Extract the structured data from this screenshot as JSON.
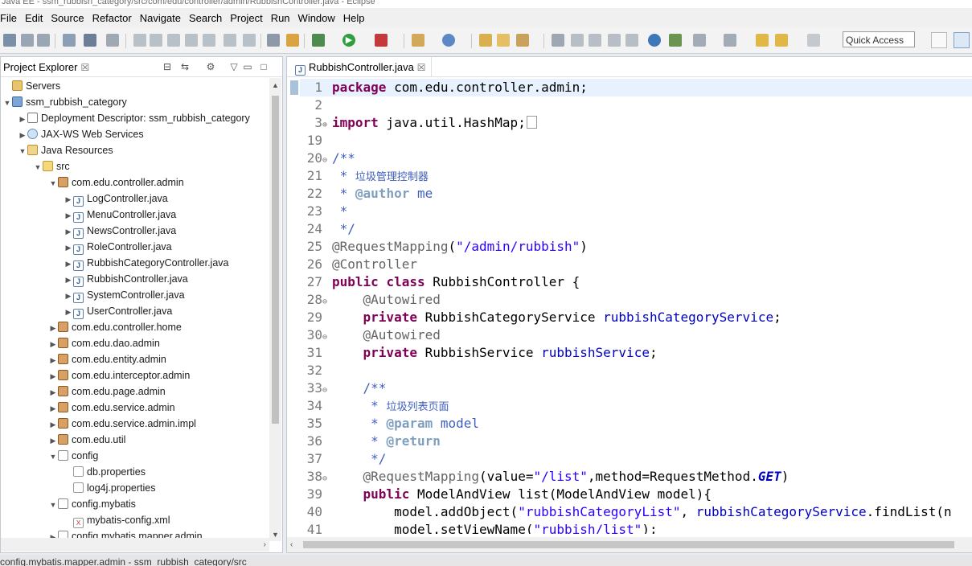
{
  "window": {
    "title": "Java EE - ssm_rubbish_category/src/com/edu/controller/admin/RubbishController.java - Eclipse"
  },
  "menubar": {
    "items": [
      "File",
      "Edit",
      "Source",
      "Refactor",
      "Navigate",
      "Search",
      "Project",
      "Run",
      "Window",
      "Help"
    ]
  },
  "toolbar": {
    "quick_access_placeholder": "Quick Access"
  },
  "explorer": {
    "tab_label": "Project Explorer",
    "close_glyph": "☒",
    "tree": [
      {
        "label": "Servers",
        "icon": "servers-icon",
        "depth": 0,
        "arrow": ""
      },
      {
        "label": "ssm_rubbish_category",
        "icon": "project-icon",
        "depth": 0,
        "arrow": "down"
      },
      {
        "label": "Deployment Descriptor: ssm_rubbish_category",
        "icon": "deployment-descriptor-icon",
        "depth": 1,
        "arrow": "right"
      },
      {
        "label": "JAX-WS Web Services",
        "icon": "jaxws-icon",
        "depth": 1,
        "arrow": "right"
      },
      {
        "label": "Java Resources",
        "icon": "java-resources-icon",
        "depth": 1,
        "arrow": "down"
      },
      {
        "label": "src",
        "icon": "source-folder-icon",
        "depth": 2,
        "arrow": "down"
      },
      {
        "label": "com.edu.controller.admin",
        "icon": "package-icon",
        "depth": 3,
        "arrow": "down"
      },
      {
        "label": "LogController.java",
        "icon": "java-file-icon",
        "depth": 4,
        "arrow": "right"
      },
      {
        "label": "MenuController.java",
        "icon": "java-file-icon",
        "depth": 4,
        "arrow": "right"
      },
      {
        "label": "NewsController.java",
        "icon": "java-file-icon",
        "depth": 4,
        "arrow": "right"
      },
      {
        "label": "RoleController.java",
        "icon": "java-file-icon",
        "depth": 4,
        "arrow": "right"
      },
      {
        "label": "RubbishCategoryController.java",
        "icon": "java-file-icon",
        "depth": 4,
        "arrow": "right"
      },
      {
        "label": "RubbishController.java",
        "icon": "java-file-icon",
        "depth": 4,
        "arrow": "right"
      },
      {
        "label": "SystemController.java",
        "icon": "java-file-icon",
        "depth": 4,
        "arrow": "right"
      },
      {
        "label": "UserController.java",
        "icon": "java-file-icon",
        "depth": 4,
        "arrow": "right"
      },
      {
        "label": "com.edu.controller.home",
        "icon": "package-icon",
        "depth": 3,
        "arrow": "right"
      },
      {
        "label": "com.edu.dao.admin",
        "icon": "package-icon",
        "depth": 3,
        "arrow": "right"
      },
      {
        "label": "com.edu.entity.admin",
        "icon": "package-icon",
        "depth": 3,
        "arrow": "right"
      },
      {
        "label": "com.edu.interceptor.admin",
        "icon": "package-icon",
        "depth": 3,
        "arrow": "right"
      },
      {
        "label": "com.edu.page.admin",
        "icon": "package-icon",
        "depth": 3,
        "arrow": "right"
      },
      {
        "label": "com.edu.service.admin",
        "icon": "package-icon",
        "depth": 3,
        "arrow": "right"
      },
      {
        "label": "com.edu.service.admin.impl",
        "icon": "package-icon",
        "depth": 3,
        "arrow": "right"
      },
      {
        "label": "com.edu.util",
        "icon": "package-icon",
        "depth": 3,
        "arrow": "right"
      },
      {
        "label": "config",
        "icon": "folder-package-icon",
        "depth": 3,
        "arrow": "down"
      },
      {
        "label": "db.properties",
        "icon": "properties-file-icon",
        "depth": 4,
        "arrow": ""
      },
      {
        "label": "log4j.properties",
        "icon": "properties-file-icon",
        "depth": 4,
        "arrow": ""
      },
      {
        "label": "config.mybatis",
        "icon": "folder-package-icon",
        "depth": 3,
        "arrow": "down"
      },
      {
        "label": "mybatis-config.xml",
        "icon": "xml-file-icon",
        "depth": 4,
        "arrow": ""
      },
      {
        "label": "config.mybatis.mapper.admin",
        "icon": "folder-package-icon",
        "depth": 3,
        "arrow": "right"
      }
    ]
  },
  "editor": {
    "tab_label": "RubbishController.java",
    "lines": [
      {
        "n": "1",
        "fold": "",
        "html": "<span class='kw'>package</span> com.edu.controller.admin;"
      },
      {
        "n": "2",
        "fold": "",
        "html": ""
      },
      {
        "n": "3",
        "fold": "⊕",
        "html": "<span class='kw'>import</span> java.util.HashMap;<span class='collapsed-box'></span>"
      },
      {
        "n": "19",
        "fold": "",
        "html": ""
      },
      {
        "n": "20",
        "fold": "⊖",
        "html": "<span class='cm'>/**</span>"
      },
      {
        "n": "21",
        "fold": "",
        "html": "<span class='cm'> * <span class='cjk'>垃圾管理控制器</span></span>"
      },
      {
        "n": "22",
        "fold": "",
        "html": "<span class='cm'> * <span class='jd'>@author</span> me</span>"
      },
      {
        "n": "23",
        "fold": "",
        "html": "<span class='cm'> *</span>"
      },
      {
        "n": "24",
        "fold": "",
        "html": "<span class='cm'> */</span>"
      },
      {
        "n": "25",
        "fold": "",
        "html": "<span class='ann'>@RequestMapping</span>(<span class='str'>\"/admin/rubbish\"</span>)"
      },
      {
        "n": "26",
        "fold": "",
        "html": "<span class='ann'>@Controller</span>"
      },
      {
        "n": "27",
        "fold": "",
        "html": "<span class='kw'>public</span> <span class='kw'>class</span> RubbishController {"
      },
      {
        "n": "28",
        "fold": "⊖",
        "html": "    <span class='ann'>@Autowired</span>"
      },
      {
        "n": "29",
        "fold": "",
        "html": "    <span class='kw'>private</span> RubbishCategoryService <span class='fld'>rubbishCategoryService</span>;"
      },
      {
        "n": "30",
        "fold": "⊖",
        "html": "    <span class='ann'>@Autowired</span>"
      },
      {
        "n": "31",
        "fold": "",
        "html": "    <span class='kw'>private</span> RubbishService <span class='fld'>rubbishService</span>;"
      },
      {
        "n": "32",
        "fold": "",
        "html": ""
      },
      {
        "n": "33",
        "fold": "⊖",
        "html": "    <span class='cm'>/**</span>"
      },
      {
        "n": "34",
        "fold": "",
        "html": "<span class='cm'>     * <span class='cjk'>垃圾列表页面</span></span>"
      },
      {
        "n": "35",
        "fold": "",
        "html": "<span class='cm'>     * <span class='jd'>@param</span> model</span>"
      },
      {
        "n": "36",
        "fold": "",
        "html": "<span class='cm'>     * <span class='jd'>@return</span></span>"
      },
      {
        "n": "37",
        "fold": "",
        "html": "<span class='cm'>     */</span>"
      },
      {
        "n": "38",
        "fold": "⊖",
        "html": "    <span class='ann'>@RequestMapping</span>(value=<span class='str'>\"/list\"</span>,method=RequestMethod.<span class='it'>GET</span>)"
      },
      {
        "n": "39",
        "fold": "",
        "html": "    <span class='kw'>public</span> ModelAndView list(ModelAndView model){"
      },
      {
        "n": "40",
        "fold": "",
        "html": "        model.addObject(<span class='str'>\"rubbishCategoryList\"</span>, <span class='fld'>rubbishCategoryService</span>.findList(n"
      },
      {
        "n": "41",
        "fold": "",
        "html": "        model.setViewName(<span class='str'>\"rubbish/list\"</span>);"
      }
    ]
  },
  "status": {
    "text": "config.mybatis.mapper.admin - ssm_rubbish_category/src"
  }
}
